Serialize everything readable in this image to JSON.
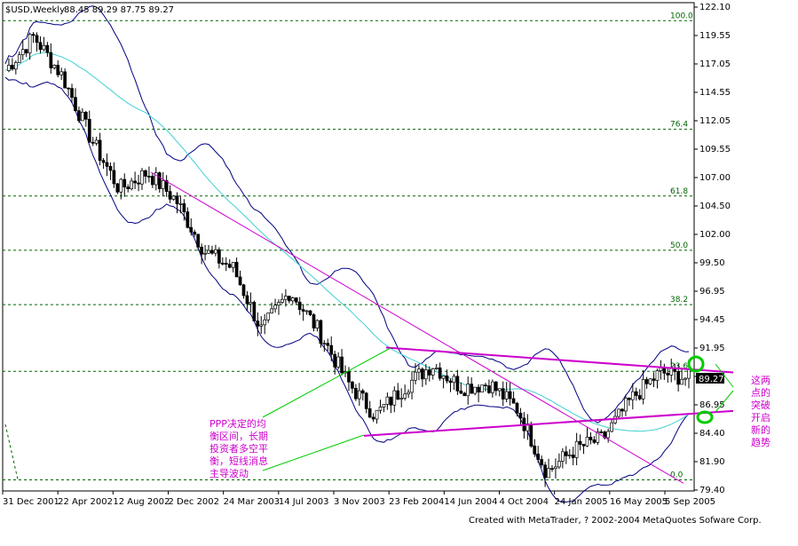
{
  "header": {
    "symbol_title": "$USD,Weekly",
    "ohlc": "88.45 89.29 87.75 89.27"
  },
  "footer": {
    "credit": "Created with MetaTrader, ? 2002-2004 MetaQuotes Sofware Corp."
  },
  "annotations": {
    "left_note": [
      "PPP决定的均",
      "衡区间，长期",
      "投资者多空平",
      "衡，短线消息",
      "主导波动"
    ],
    "right_note": [
      "这两",
      "点的",
      "突破",
      "开启",
      "新的",
      "趋势"
    ]
  },
  "colors": {
    "bollinger": "#000080",
    "ma_slow": "#40d0d0",
    "trendline": "#cc00cc",
    "fib_lines": "#006400",
    "highlight_circle": "#00cc00",
    "note_text": "#cc00cc",
    "candle_up": "#ffffff",
    "candle_down": "#000000"
  },
  "chart_data": {
    "type": "candlestick",
    "symbol": "$USD",
    "period": "Weekly",
    "current_price": "89.27",
    "ylim": [
      79.4,
      123.5
    ],
    "y_ticks": [
      "122.10",
      "119.55",
      "117.05",
      "114.55",
      "112.05",
      "109.55",
      "107.00",
      "104.50",
      "102.00",
      "99.50",
      "96.95",
      "94.45",
      "91.95",
      "89.45",
      "86.95",
      "84.40",
      "81.90",
      "79.40"
    ],
    "x_ticks": [
      "31 Dec 2001",
      "22 Apr 2002",
      "12 Aug 2002",
      "2 Dec 2002",
      "24 Mar 2003",
      "14 Jul 2003",
      "3 Nov 2003",
      "23 Feb 2004",
      "14 Jun 2004",
      "4 Oct 2004",
      "24 Jan 2005",
      "16 May 2005",
      "5 Sep 2005"
    ],
    "fibonacci": [
      {
        "label": "100.0",
        "value": 120.9
      },
      {
        "label": "76.4",
        "value": 111.3
      },
      {
        "label": "61.8",
        "value": 105.4
      },
      {
        "label": "50.0",
        "value": 100.6
      },
      {
        "label": "38.2",
        "value": 95.8
      },
      {
        "label": "23.6",
        "value": 89.9
      },
      {
        "label": "0.0",
        "value": 80.3
      }
    ],
    "close_trend": [
      {
        "x": "31 Dec 2001",
        "y": 116.5
      },
      {
        "x": "Feb 2002",
        "y": 119.5
      },
      {
        "x": "22 Apr 2002",
        "y": 116.0
      },
      {
        "x": "Jun 2002",
        "y": 110.5
      },
      {
        "x": "12 Aug 2002",
        "y": 106.0
      },
      {
        "x": "Oct 2002",
        "y": 107.5
      },
      {
        "x": "2 Dec 2002",
        "y": 105.0
      },
      {
        "x": "Feb 2003",
        "y": 100.5
      },
      {
        "x": "24 Mar 2003",
        "y": 99.0
      },
      {
        "x": "May 2003",
        "y": 93.5
      },
      {
        "x": "14 Jul 2003",
        "y": 97.0
      },
      {
        "x": "Sep 2003",
        "y": 93.5
      },
      {
        "x": "3 Nov 2003",
        "y": 89.0
      },
      {
        "x": "Jan 2004",
        "y": 86.0
      },
      {
        "x": "23 Feb 2004",
        "y": 88.5
      },
      {
        "x": "Apr 2004",
        "y": 90.5
      },
      {
        "x": "14 Jun 2004",
        "y": 88.5
      },
      {
        "x": "Aug 2004",
        "y": 88.8
      },
      {
        "x": "4 Oct 2004",
        "y": 86.5
      },
      {
        "x": "Dec 2004",
        "y": 81.0
      },
      {
        "x": "24 Jan 2005",
        "y": 83.0
      },
      {
        "x": "Mar 2005",
        "y": 84.0
      },
      {
        "x": "16 May 2005",
        "y": 87.5
      },
      {
        "x": "Jul 2005",
        "y": 89.8
      },
      {
        "x": "5 Sep 2005",
        "y": 89.27
      }
    ]
  }
}
